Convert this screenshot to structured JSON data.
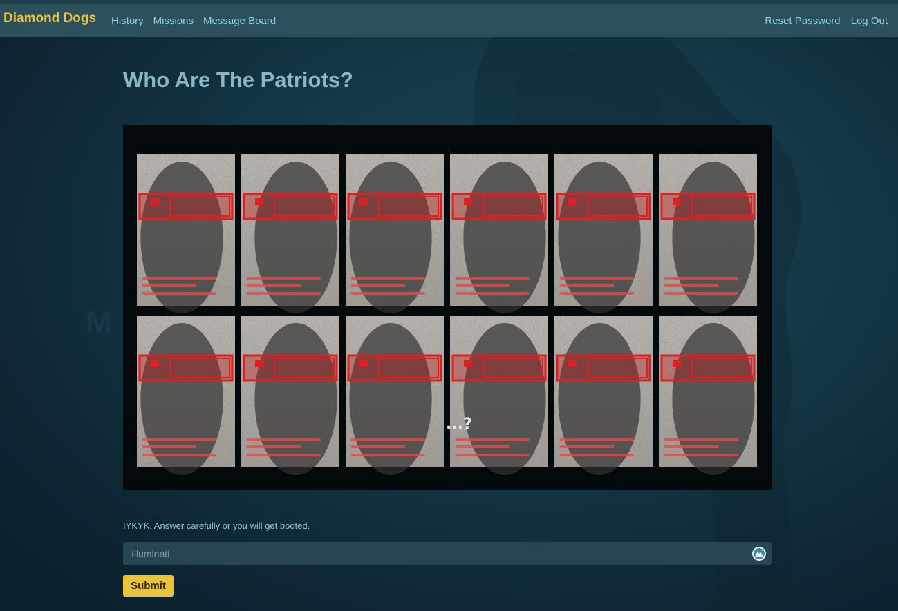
{
  "brand": "Diamond Dogs",
  "nav": {
    "left": [
      "History",
      "Missions",
      "Message Board"
    ],
    "right": [
      "Reset Password",
      "Log Out"
    ]
  },
  "page": {
    "title": "Who Are The Patriots?",
    "image_caption": "...?"
  },
  "form": {
    "hint": "IYKYK. Answer carefully or you will get booted.",
    "answer_placeholder": "Illuminati",
    "answer_value": "",
    "submit_label": "Submit"
  },
  "icons": {
    "vpn": "vpn-extension-icon"
  },
  "colors": {
    "brand": "#e9c440",
    "nav_link": "#8fd3ea",
    "title": "#8ab6c7",
    "button": "#e9c33b",
    "highlight_red": "#e02020"
  }
}
